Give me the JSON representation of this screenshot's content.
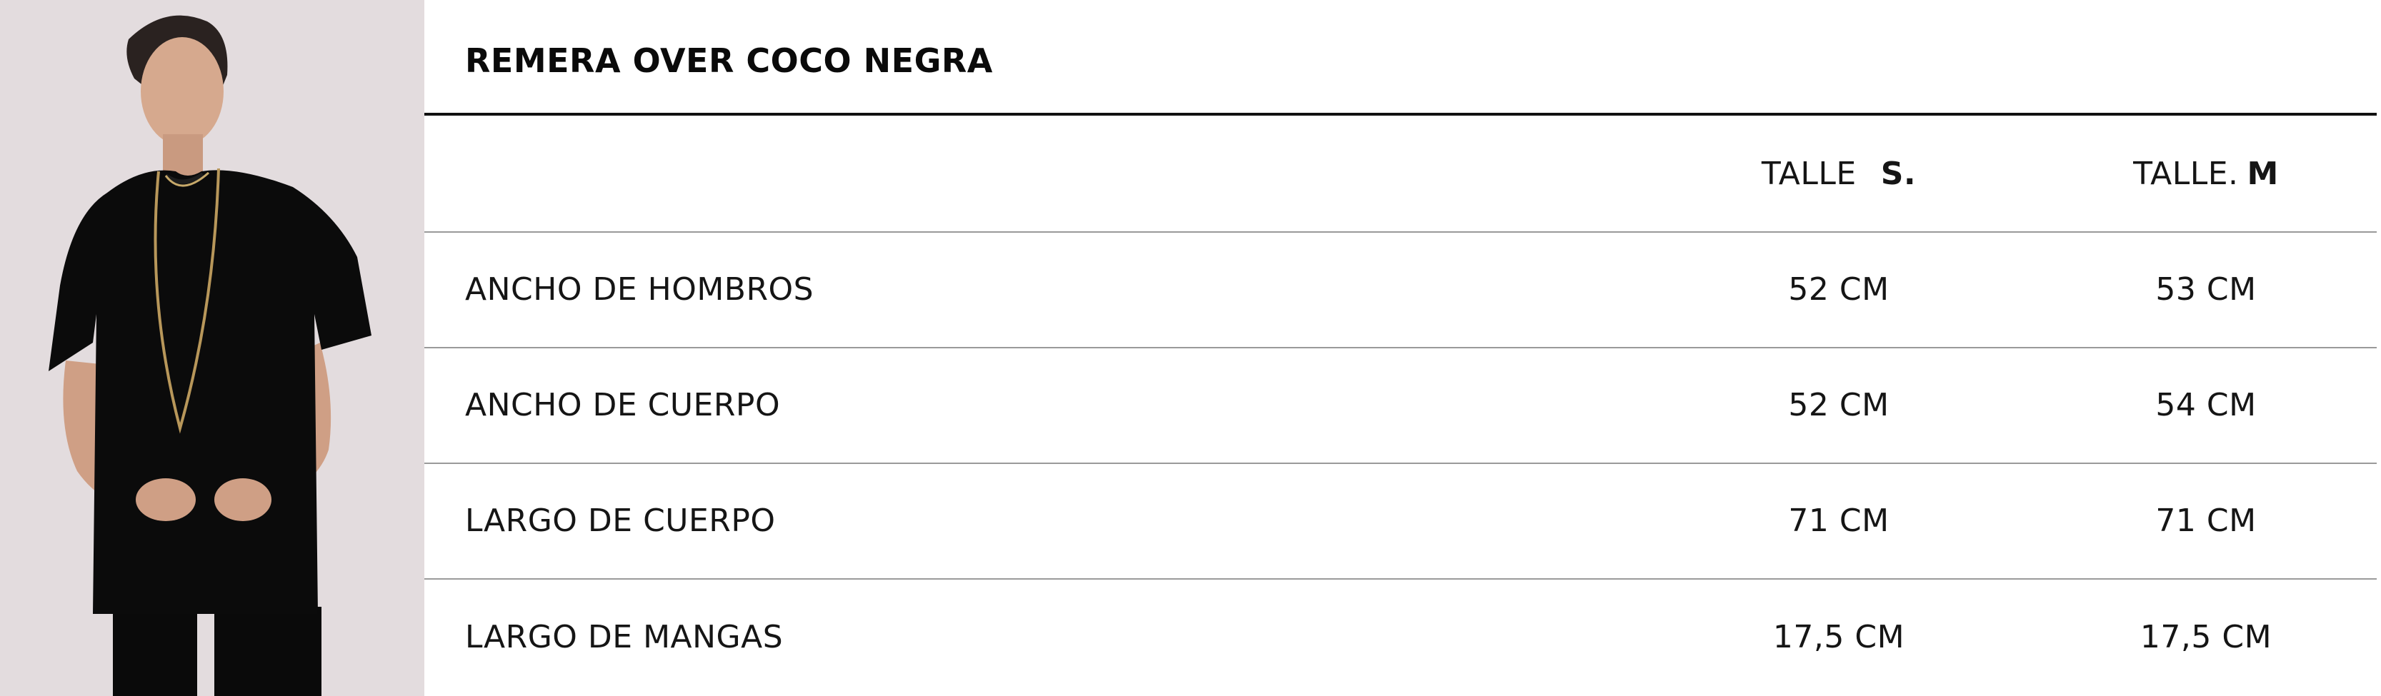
{
  "product": {
    "title": "REMERA OVER COCO NEGRA",
    "photo_alt": "model-wearing-black-tshirt"
  },
  "table": {
    "header": {
      "label": "",
      "size_s": {
        "prefix": "TALLE",
        "bold": "S."
      },
      "size_m": {
        "prefix": "TALLE.",
        "bold": "M"
      }
    },
    "rows": [
      {
        "label": "ANCHO DE HOMBROS",
        "s": "52 CM",
        "m": "53 CM"
      },
      {
        "label": "ANCHO DE CUERPO",
        "s": "52 CM",
        "m": "54 CM"
      },
      {
        "label": "LARGO DE CUERPO",
        "s": "71 CM",
        "m": "71 CM"
      },
      {
        "label": "LARGO DE MANGAS",
        "s": "17,5 CM",
        "m": "17,5 CM"
      }
    ]
  },
  "colors": {
    "photo_background": "#e3dcde",
    "garment": "#0b0b0b",
    "rule": "#111111",
    "divider": "#9a9a9a"
  }
}
